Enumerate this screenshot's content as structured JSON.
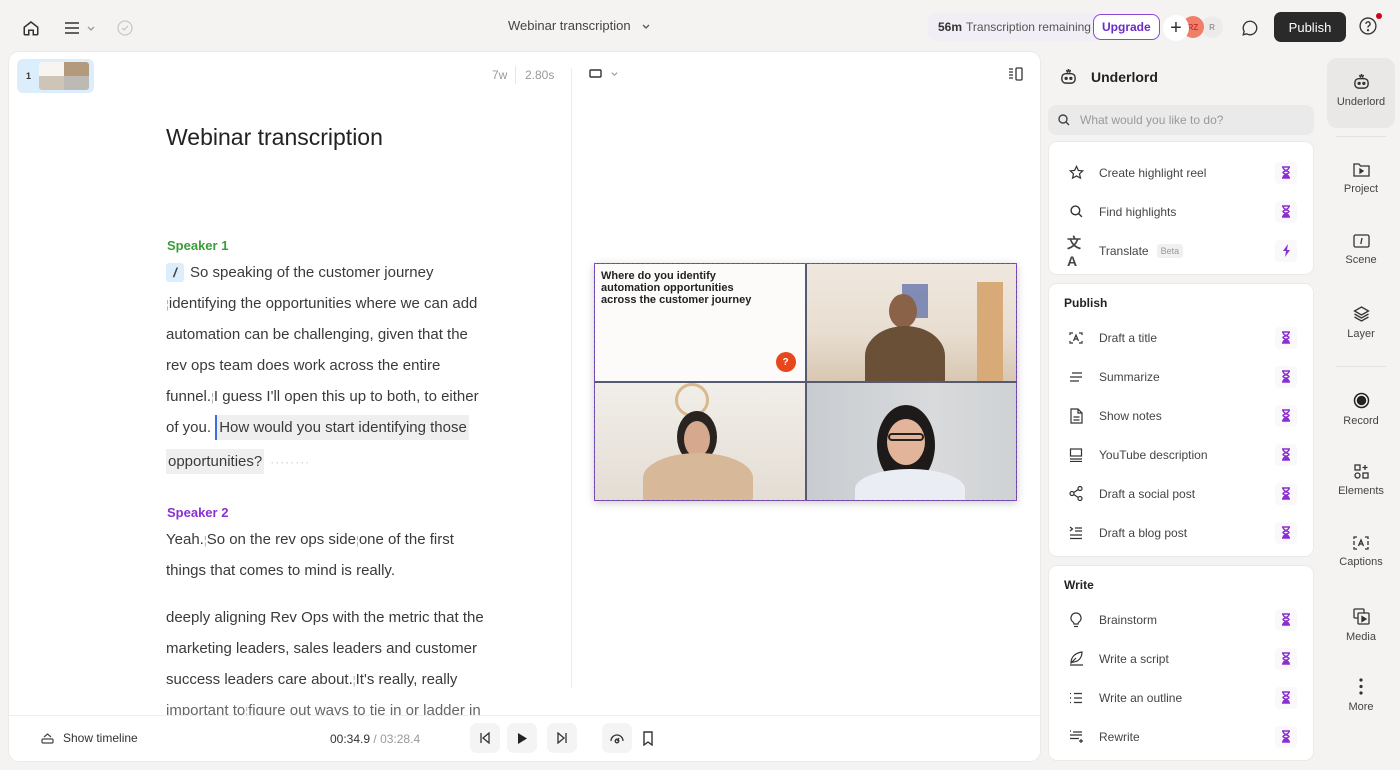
{
  "topbar": {
    "doc_title": "Webinar transcription",
    "transcription_amount": "56m",
    "transcription_label": "Transcription remaining",
    "upgrade_label": "Upgrade",
    "add_label": "+",
    "avatars": [
      "RZ",
      "R"
    ],
    "publish_label": "Publish"
  },
  "editor": {
    "scene_number": "1",
    "word_count": "7w",
    "duration": "2.80s",
    "title": "Webinar transcription",
    "speaker1": {
      "name": "Speaker 1",
      "slash": "/",
      "lines": [
        "So speaking of the customer journey",
        "identifying the opportunities where we can add",
        "automation can be challenging, given that the",
        "rev ops team does work across the entire",
        "funnel.",
        "I guess I'll open this up to both, to either",
        "of you.",
        "How would you start identifying those",
        "opportunities?"
      ]
    },
    "speaker2": {
      "name": "Speaker 2",
      "lines": [
        "Yeah.",
        "So on the rev ops side",
        "one of the first",
        "things that comes to mind is really.",
        "deeply aligning Rev Ops with the metric that the",
        "marketing leaders, sales leaders and customer",
        "success leaders care about.",
        "It's really, really",
        "important to",
        "figure out ways to tie in or ladder in"
      ]
    },
    "video": {
      "slide_text": "Where do you identify automation opportunities across the customer journey",
      "slide_badge": "?"
    },
    "bottom": {
      "show_timeline": "Show timeline",
      "current_time": "00:34.9",
      "separator": "/",
      "total_time": "03:28.4"
    }
  },
  "underlord": {
    "title": "Underlord",
    "search_placeholder": "What would you like to do?",
    "top_items": [
      {
        "label": "Create highlight reel",
        "icon": "star-icon",
        "badge": "hourglass-icon"
      },
      {
        "label": "Find highlights",
        "icon": "search-icon",
        "badge": "hourglass-icon"
      },
      {
        "label": "Translate",
        "tag": "Beta",
        "icon": "translate-icon",
        "badge": "lightning-icon"
      }
    ],
    "publish": {
      "title": "Publish",
      "items": [
        {
          "label": "Draft a title",
          "icon": "title-box-icon"
        },
        {
          "label": "Summarize",
          "icon": "summary-lines-icon"
        },
        {
          "label": "Show notes",
          "icon": "document-icon"
        },
        {
          "label": "YouTube description",
          "icon": "monitor-lines-icon"
        },
        {
          "label": "Draft a social post",
          "icon": "share-icon"
        },
        {
          "label": "Draft a blog post",
          "icon": "indent-list-icon"
        }
      ]
    },
    "write": {
      "title": "Write",
      "items": [
        {
          "label": "Brainstorm",
          "icon": "lightbulb-icon"
        },
        {
          "label": "Write a script",
          "icon": "quill-icon"
        },
        {
          "label": "Write an outline",
          "icon": "bullet-list-icon"
        },
        {
          "label": "Rewrite",
          "icon": "rewrite-icon"
        }
      ]
    }
  },
  "rail": [
    {
      "label": "Underlord",
      "icon": "robot-icon",
      "active": true
    },
    {
      "label": "Project",
      "icon": "folder-play-icon"
    },
    {
      "label": "Scene",
      "icon": "scene-icon"
    },
    {
      "label": "Layer",
      "icon": "layers-icon"
    },
    {
      "label": "Record",
      "icon": "record-icon"
    },
    {
      "label": "Elements",
      "icon": "elements-icon"
    },
    {
      "label": "Captions",
      "icon": "captions-icon"
    },
    {
      "label": "Media",
      "icon": "media-icon"
    },
    {
      "label": "More",
      "icon": "more-vertical-icon"
    }
  ],
  "colors": {
    "accent_purple": "#8a2fd0",
    "speaker1_green": "#3a9d3a",
    "publish_bg": "#2a2a2a",
    "selection_blue": "#dcedfb"
  }
}
